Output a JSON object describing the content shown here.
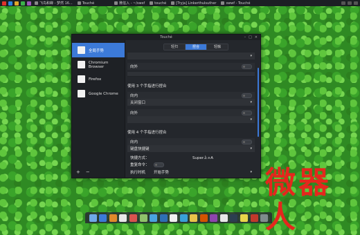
{
  "topbar": {
    "tasks": [
      {
        "label": "飞鸟和蝉 - 梦然 16..."
      },
      {
        "label": "Touché"
      },
      {
        "label": "微信入 - ~/swsf"
      },
      {
        "label": "touché"
      },
      {
        "label": "[Tryja] Linkerthulsuther"
      },
      {
        "label": "swwf - Touché"
      }
    ],
    "colors": [
      "#e0322b",
      "#2b83e0",
      "#e0a82b",
      "#3bb34a",
      "#9b59b6",
      "#e0e0e0"
    ]
  },
  "window": {
    "title": "Touché",
    "buttons": [
      "–",
      "□",
      "×"
    ]
  },
  "sidebar": {
    "items": [
      {
        "label": "全局手势"
      },
      {
        "label": "Chromium Browser"
      },
      {
        "label": "Firefox"
      },
      {
        "label": "Google Chrome"
      }
    ],
    "add_label": "+",
    "remove_label": "−"
  },
  "tabs": [
    {
      "label": "轻扫"
    },
    {
      "label": "捏合"
    },
    {
      "label": "轻触"
    }
  ],
  "content": {
    "out_label_1": "向外",
    "section_3": "使用 3 个手指进行捏合",
    "in_label_3": "向内",
    "in_value_3": "关闭窗口",
    "out_label_3": "向外",
    "section_4": "使用 4 个手指进行捏合",
    "in_label_4": "向内",
    "in_value_4": "键盘快捷键",
    "shortcut_label": "快捷方式：",
    "shortcut_value": "Super上+A",
    "repeat_label": "重复命令：",
    "bottom_label": "执行时机",
    "bottom_value": "开始手势"
  },
  "watermark": "微器人",
  "dock": {
    "colors": [
      "#6fa8e8",
      "#3c7ad8",
      "#e08a2b",
      "#e8e8e8",
      "#d9534f",
      "#8fc26a",
      "#4aa3df",
      "#2e6fb3",
      "#f0f0f0",
      "#39a0d8",
      "#e8c34a",
      "#d35400",
      "#8e44ad",
      "#e8e8e8",
      "#2c3e50",
      "#e8d64a",
      "#c0392b",
      "#7f8c8d"
    ]
  }
}
